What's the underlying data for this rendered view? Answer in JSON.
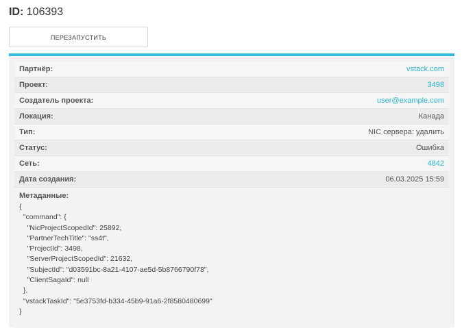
{
  "header": {
    "id_label": "ID:",
    "id_value": "106393"
  },
  "toolbar": {
    "restart_label": "ПЕРЕЗАПУСТИТЬ"
  },
  "details": [
    {
      "key": "Партнёр:",
      "value": "vstack.com",
      "link": true
    },
    {
      "key": "Проект:",
      "value": "3498",
      "link": true
    },
    {
      "key": "Создатель проекта:",
      "value": "user@example.com",
      "link": true
    },
    {
      "key": "Локация:",
      "value": "Канада",
      "link": false
    },
    {
      "key": "Тип:",
      "value": "NIC сервера: удалить",
      "link": false
    },
    {
      "key": "Статус:",
      "value": "Ошибка",
      "link": false
    },
    {
      "key": "Сеть:",
      "value": "4842",
      "link": true
    },
    {
      "key": "Дата создания:",
      "value": "06.03.2025 15:59",
      "link": false
    }
  ],
  "metadata": {
    "label": "Метаданные:",
    "json_text": "{\n  \"command\": {\n    \"NicProjectScopedId\": 25892,\n    \"PartnerTechTitle\": \"ss4t\",\n    \"ProjectId\": 3498,\n    \"ServerProjectScopedId\": 21632,\n    \"SubjectId\": \"d03591bc-8a21-4107-ae5d-5b8766790f78\",\n    \"ClientSagaId\": null\n  },\n  \"vstackTaskId\": \"5e3753fd-b334-45b9-91a6-2f8580480699\"\n}"
  },
  "colors": {
    "accent": "#2fbcd4",
    "link": "#2bb3cc"
  }
}
